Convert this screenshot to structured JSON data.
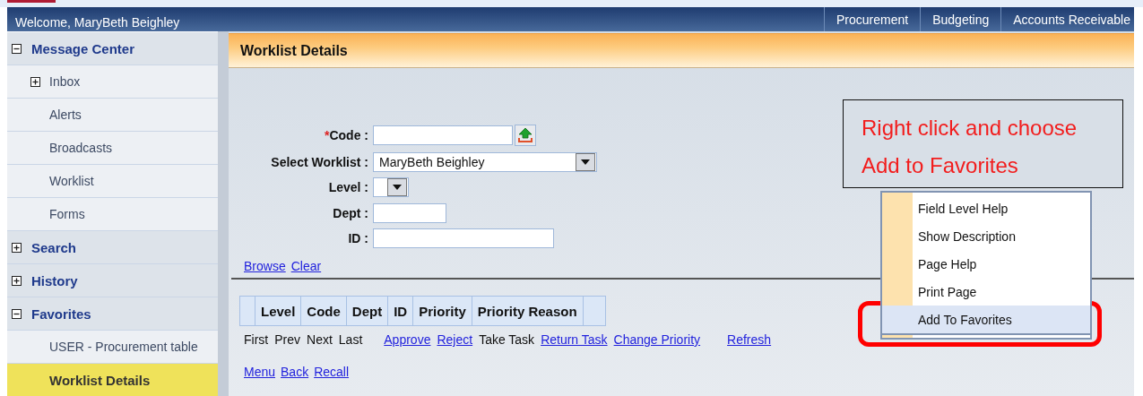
{
  "header": {
    "welcome": "Welcome, MaryBeth Beighley",
    "nav": [
      "Procurement",
      "Budgeting",
      "Accounts Receivable"
    ]
  },
  "sidebar": {
    "items": [
      {
        "label": "Message Center",
        "expanded": true,
        "children": [
          {
            "label": "Inbox",
            "kind": "folder",
            "expanded": false,
            "selected": false
          },
          {
            "label": "Alerts",
            "kind": "page",
            "selected": false
          },
          {
            "label": "Broadcasts",
            "kind": "page",
            "selected": false
          },
          {
            "label": "Worklist",
            "kind": "page",
            "selected": false
          },
          {
            "label": "Forms",
            "kind": "page",
            "selected": false
          }
        ]
      },
      {
        "label": "Search",
        "expanded": false
      },
      {
        "label": "History",
        "expanded": false
      },
      {
        "label": "Favorites",
        "expanded": true,
        "children": [
          {
            "label": "USER - Procurement table",
            "kind": "page",
            "selected": false
          },
          {
            "label": "Worklist Details",
            "kind": "page",
            "selected": true
          }
        ]
      }
    ]
  },
  "page": {
    "title": "Worklist Details",
    "fields": [
      {
        "label": "Code :",
        "required_mark": "*",
        "kind": "lookup"
      },
      {
        "label": "Select Worklist :",
        "kind": "select",
        "value": "MaryBeth Beighley"
      },
      {
        "label": "Level :",
        "kind": "select"
      },
      {
        "label": "Dept :",
        "kind": "text"
      },
      {
        "label": "ID :",
        "kind": "text"
      }
    ],
    "form_links": [
      "Browse",
      "Clear"
    ],
    "table": {
      "columns": [
        "Level",
        "Code",
        "Dept",
        "ID",
        "Priority",
        "Priority Reason"
      ]
    },
    "pager": [
      "First",
      "Prev",
      "Next",
      "Last"
    ],
    "actions": [
      {
        "label": "Approve",
        "kind": "link"
      },
      {
        "label": "Reject",
        "kind": "link"
      },
      {
        "label": "Take Task",
        "kind": "text"
      },
      {
        "label": "Return Task",
        "kind": "link"
      },
      {
        "label": "Change Priority",
        "kind": "link"
      },
      {
        "label": "Refresh",
        "kind": "link"
      }
    ],
    "bottom_links": [
      "Menu",
      "Back",
      "Recall"
    ]
  },
  "callout": {
    "lines": [
      "Right click and choose",
      "Add to Favorites"
    ]
  },
  "context_menu": {
    "items": [
      {
        "label": "Field Level Help",
        "selected": false
      },
      {
        "label": "Show Description",
        "selected": false
      },
      {
        "label": "Page Help",
        "selected": false
      },
      {
        "label": "Print Page",
        "selected": false
      },
      {
        "label": "Add To Favorites",
        "selected": true
      }
    ]
  }
}
